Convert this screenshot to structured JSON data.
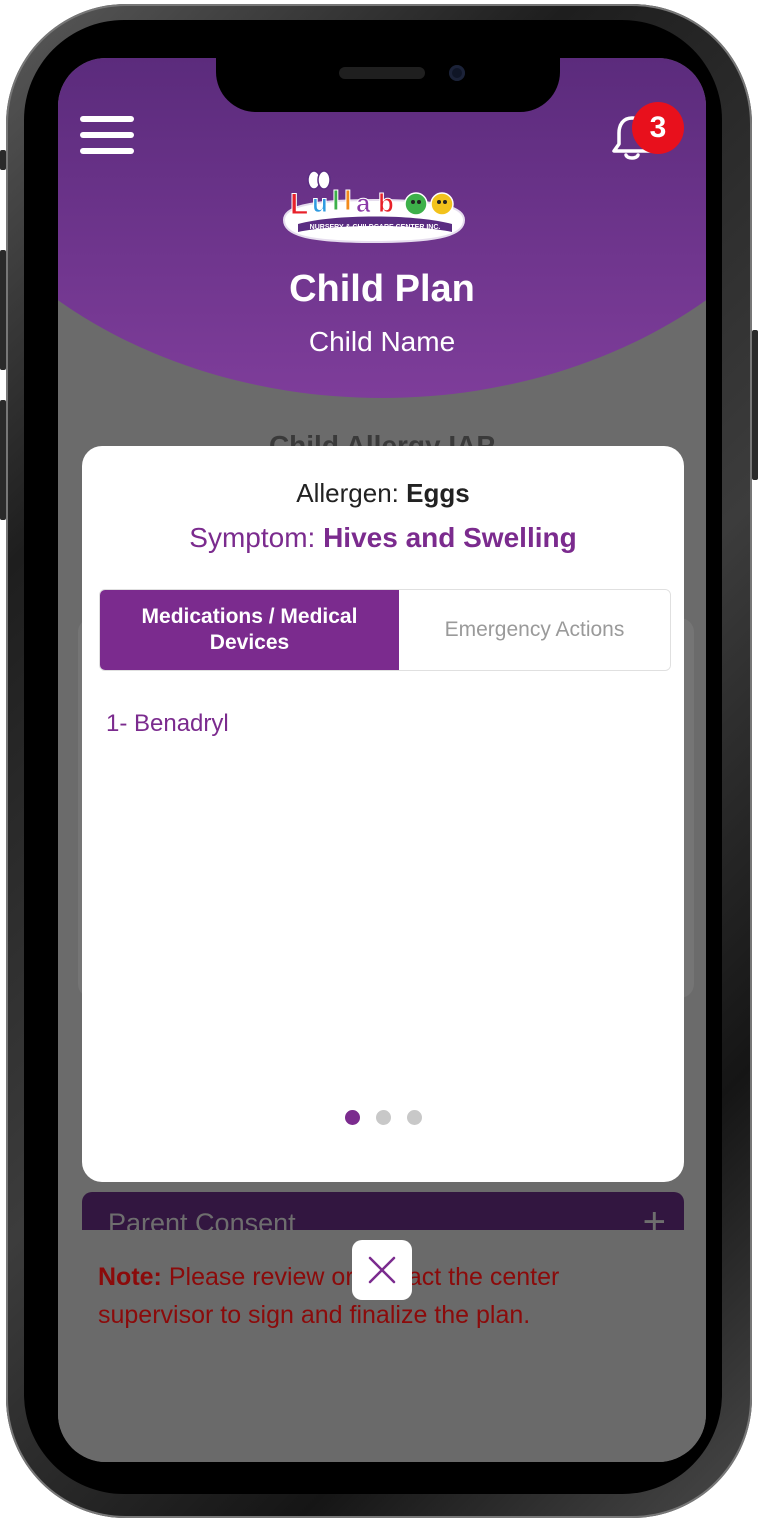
{
  "header": {
    "title": "Child Plan",
    "subtitle": "Child Name",
    "notifications_count": "3"
  },
  "logo": {
    "name": "Lullaboo",
    "tagline": "NURSERY & CHILDCARE CENTER INC."
  },
  "background": {
    "section_title": "Child Allergy IAP",
    "consent_label": "Parent Consent",
    "consent_toggle": "+"
  },
  "note": {
    "label": "Note:",
    "text": " Please review or contact the center supervisor to sign and finalize the plan."
  },
  "modal": {
    "allergen_label": "Allergen: ",
    "allergen_value": "Eggs",
    "symptom_label": "Symptom: ",
    "symptom_value": "Hives and Swelling",
    "tabs": [
      {
        "label": "Medications / Medical Devices",
        "active": true
      },
      {
        "label": "Emergency Actions",
        "active": false
      }
    ],
    "items": [
      "1- Benadryl"
    ],
    "pager": {
      "total": 3,
      "current": 1
    }
  },
  "colors": {
    "accent": "#7b2b8e",
    "header_dark": "#3d1b56",
    "badge": "#e8101c",
    "note_text": "#8b0a0a"
  },
  "icons": {
    "menu": "hamburger-menu-icon",
    "notifications": "bell-icon",
    "close": "close-icon"
  }
}
